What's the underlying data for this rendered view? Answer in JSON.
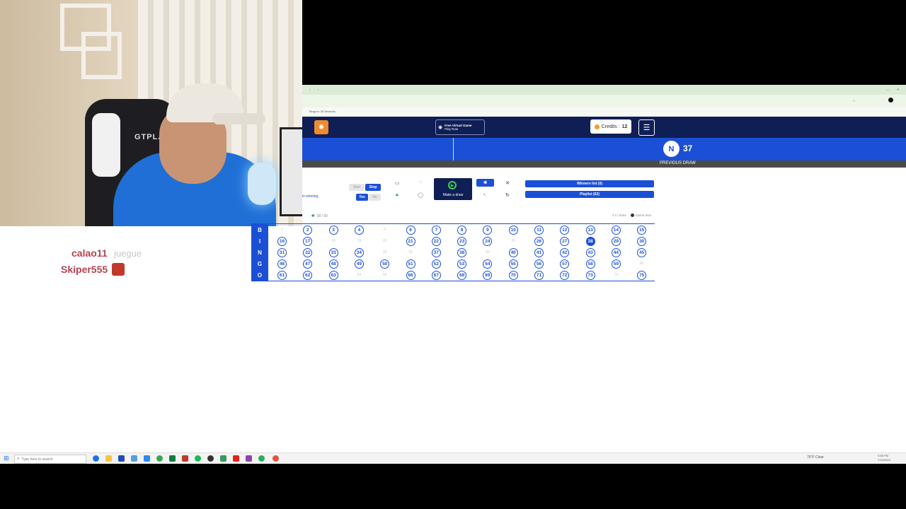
{
  "webcam": {
    "chair_brand": "GTPLAYER"
  },
  "chat": [
    {
      "user": "calao11",
      "message": "juegue"
    },
    {
      "user": "Skiper555",
      "message": ""
    }
  ],
  "browser": {
    "tab_title": "Bingo in 30 Seconds",
    "header": {
      "promo_title": "Free Virtual Game",
      "promo_sub": "Play Now",
      "credits_label": "Credits :",
      "credits_value": "12",
      "menu_icon": "hamburger-icon"
    },
    "draw": {
      "letter": "N",
      "number": "37",
      "previous_label": "PREVIOUS DRAW"
    },
    "controls": {
      "winning_label": "in winning",
      "start_label": "Start",
      "stop_label": "Stop",
      "yes_label": "Yes",
      "no_label": "No",
      "make_draw_label": "Make a draw",
      "winners_label": "Winners list (0)",
      "playlist_label": "Playlist (62)",
      "count_label": "38 / 50",
      "right_hint": "2 s / draw",
      "auto_label": "Game auto"
    },
    "board": {
      "rows": [
        "B",
        "I",
        "N",
        "G",
        "O"
      ],
      "numbers": [
        [
          1,
          2,
          3,
          4,
          5,
          6,
          7,
          8,
          9,
          10,
          11,
          12,
          13,
          14,
          15
        ],
        [
          16,
          17,
          18,
          19,
          20,
          21,
          22,
          23,
          24,
          25,
          26,
          27,
          28,
          29,
          30
        ],
        [
          31,
          32,
          33,
          34,
          35,
          36,
          37,
          38,
          39,
          40,
          41,
          42,
          43,
          44,
          45
        ],
        [
          46,
          47,
          48,
          49,
          50,
          51,
          52,
          53,
          54,
          55,
          56,
          57,
          58,
          59,
          60
        ],
        [
          61,
          62,
          63,
          64,
          65,
          66,
          67,
          68,
          69,
          70,
          71,
          72,
          73,
          74,
          75
        ]
      ],
      "uncalled": [
        1,
        5,
        18,
        19,
        20,
        25,
        35,
        36,
        39,
        60,
        64,
        65,
        74
      ],
      "current": 28
    }
  },
  "taskbar": {
    "search_placeholder": "Type here to search",
    "weather": "76°F Clear",
    "clock_time": "9:55 PM",
    "clock_date": "7/10/2023"
  },
  "colors": {
    "accent": "#1b4fd6",
    "header": "#0f1e55",
    "chat_name": "#b5424f"
  }
}
